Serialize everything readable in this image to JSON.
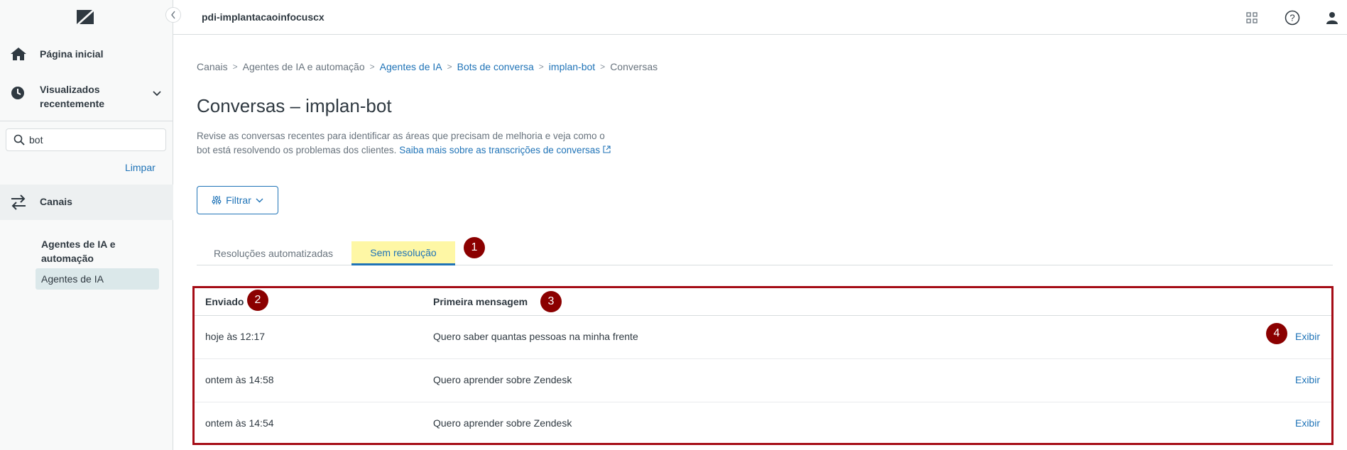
{
  "header": {
    "instance": "pdi-implantacaoinfocuscx",
    "icons": [
      "apps-grid-icon",
      "help-icon",
      "user-icon"
    ]
  },
  "sidebar": {
    "home_label": "Página inicial",
    "recent_label": "Visualizados recentemente",
    "search": {
      "value": "bot",
      "placeholder": ""
    },
    "clear_label": "Limpar",
    "channels_label": "Canais",
    "group_label": "Agentes de IA e automação",
    "active_item": "Agentes de IA"
  },
  "breadcrumb": [
    {
      "label": "Canais",
      "link": false
    },
    {
      "label": "Agentes de IA e automação",
      "link": false
    },
    {
      "label": "Agentes de IA",
      "link": true
    },
    {
      "label": "Bots de conversa",
      "link": true
    },
    {
      "label": "implan-bot",
      "link": true
    },
    {
      "label": "Conversas",
      "link": false
    }
  ],
  "page": {
    "title": "Conversas – implan-bot",
    "description": "Revise as conversas recentes para identificar as áreas que precisam de melhoria e veja como o bot está resolvendo os problemas dos clientes.",
    "learn_more": "Saiba mais sobre as transcrições de conversas",
    "filter_label": "Filtrar"
  },
  "tabs": [
    {
      "label": "Resoluções automatizadas",
      "active": false
    },
    {
      "label": "Sem resolução",
      "active": true
    }
  ],
  "table": {
    "columns": [
      "Enviado",
      "Primeira mensagem"
    ],
    "rows": [
      {
        "sent": "hoje às 12:17",
        "first_message": "Quero saber quantas pessoas na minha frente",
        "action": "Exibir"
      },
      {
        "sent": "ontem às 14:58",
        "first_message": "Quero aprender sobre Zendesk",
        "action": "Exibir"
      },
      {
        "sent": "ontem às 14:54",
        "first_message": "Quero aprender sobre Zendesk",
        "action": "Exibir"
      }
    ]
  },
  "annotations": [
    "1",
    "2",
    "3",
    "4"
  ],
  "colors": {
    "accent": "#1f73b7",
    "highlight": "#fef7a5",
    "annotation": "#8b0000",
    "frame": "#a50c16",
    "sidebar_bg": "#f8f9f9"
  }
}
